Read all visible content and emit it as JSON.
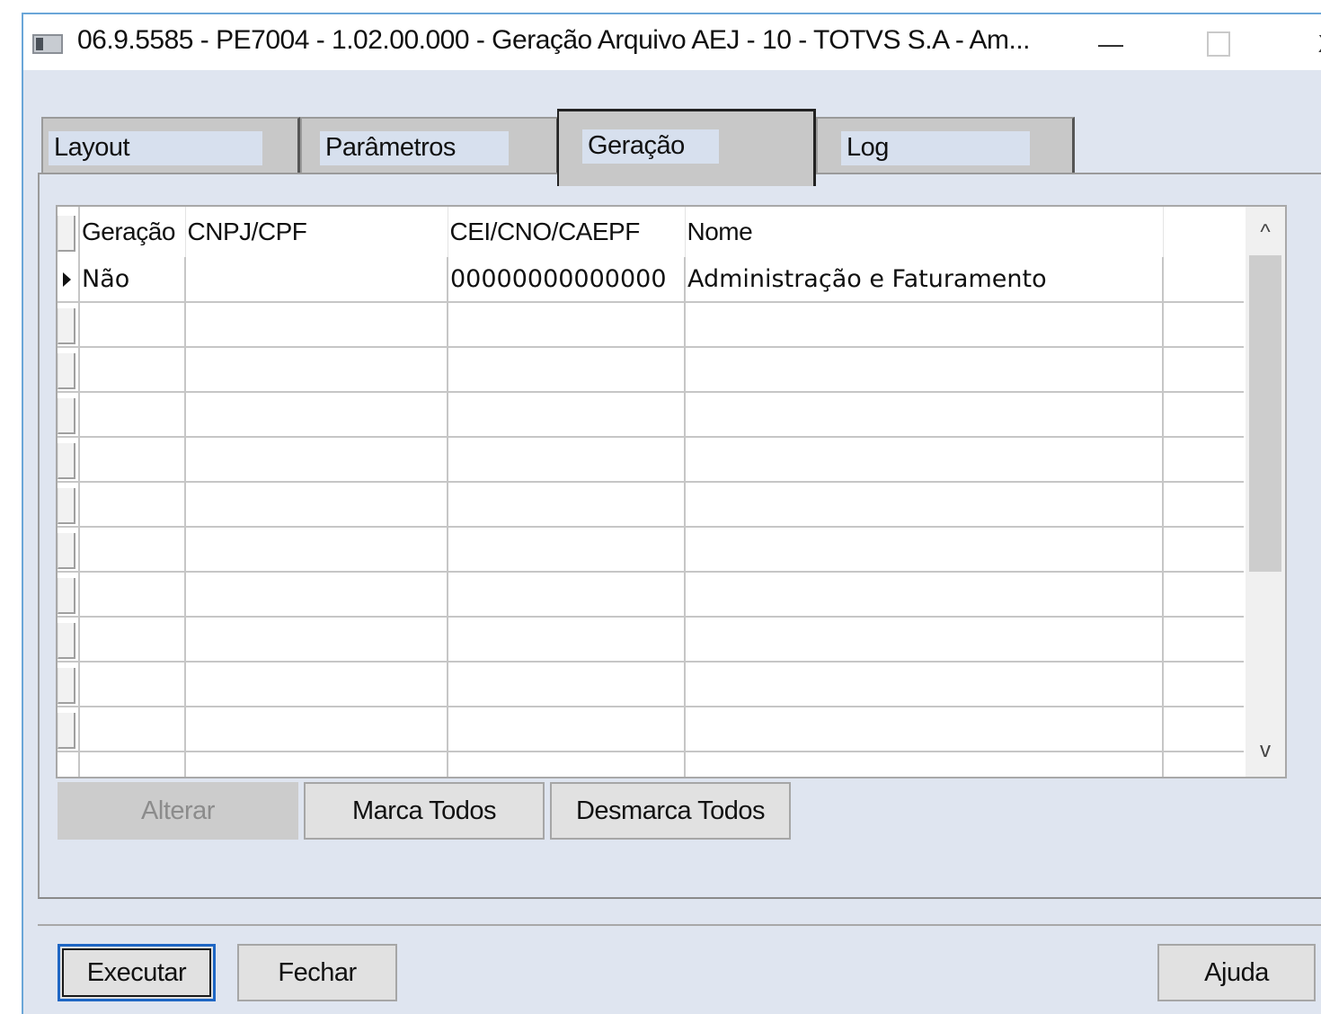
{
  "window": {
    "title": "06.9.5585 - PE7004 - 1.02.00.000 - Geração Arquivo AEJ - 10 - TOTVS S.A - Am...",
    "minimize_glyph": "—",
    "close_glyph": "X"
  },
  "tabs": [
    {
      "label": "Layout"
    },
    {
      "label": "Parâmetros"
    },
    {
      "label": "Geração"
    },
    {
      "label": "Log"
    }
  ],
  "active_tab": "Geração",
  "grid": {
    "columns": [
      "Geração",
      "CNPJ/CPF",
      "CEI/CNO/CAEPF",
      "Nome"
    ],
    "rows": [
      {
        "geracao": "Não",
        "cnpj_cpf": "",
        "cei_cno_caepf": "00000000000000",
        "nome": "Administração e Faturamento"
      }
    ],
    "scroll_up_glyph": "^",
    "scroll_down_glyph": "v"
  },
  "actions": {
    "alterar": "Alterar",
    "marca_todos": "Marca Todos",
    "desmarca_todos": "Desmarca Todos"
  },
  "footer": {
    "executar": "Executar",
    "fechar": "Fechar",
    "ajuda": "Ajuda"
  },
  "colors": {
    "window_bg": "#dfe5f0",
    "tab_label_bg": "#d7e0ee",
    "default_button_border": "#1e66c4"
  }
}
